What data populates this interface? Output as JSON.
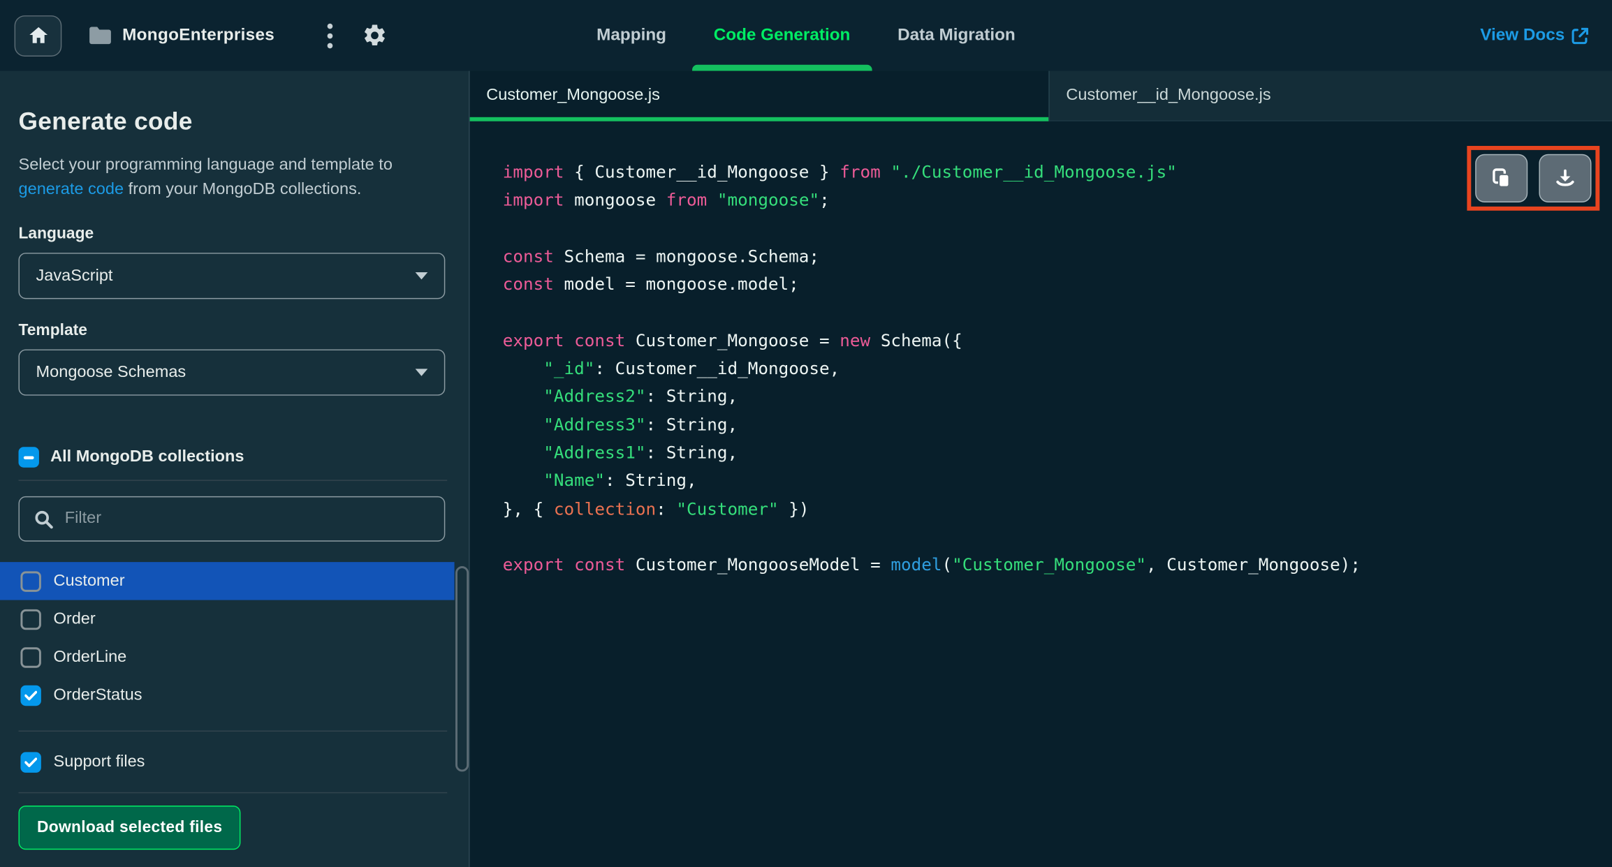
{
  "topbar": {
    "project_name": "MongoEnterprises",
    "nav_tabs": [
      {
        "label": "Mapping",
        "active": false
      },
      {
        "label": "Code Generation",
        "active": true
      },
      {
        "label": "Data Migration",
        "active": false
      }
    ],
    "view_docs_label": "View Docs"
  },
  "sidebar": {
    "title": "Generate code",
    "description": {
      "prefix": "Select your programming language and template to ",
      "link": "generate code",
      "suffix": " from your MongoDB collections."
    },
    "language": {
      "label": "Language",
      "value": "JavaScript"
    },
    "template": {
      "label": "Template",
      "value": "Mongoose Schemas"
    },
    "all_collections": {
      "label": "All MongoDB collections",
      "checkbox_state": "indeterminate"
    },
    "filter": {
      "placeholder": "Filter"
    },
    "collections": [
      {
        "name": "Customer",
        "checked": false,
        "selected": true
      },
      {
        "name": "Order",
        "checked": false,
        "selected": false
      },
      {
        "name": "OrderLine",
        "checked": false,
        "selected": false
      },
      {
        "name": "OrderStatus",
        "checked": true,
        "selected": false
      }
    ],
    "support_files": {
      "label": "Support files",
      "checked": true
    },
    "download_button_label": "Download selected files"
  },
  "editor": {
    "file_tabs": [
      {
        "label": "Customer_Mongoose.js",
        "active": true
      },
      {
        "label": "Customer__id_Mongoose.js",
        "active": false
      }
    ],
    "actions": [
      {
        "name": "copy",
        "icon": "copy-icon"
      },
      {
        "name": "download",
        "icon": "download-icon"
      }
    ],
    "code_lines": [
      {
        "tokens": [
          {
            "t": "kw",
            "v": "import"
          },
          {
            "t": "pl",
            "v": " { Customer__id_Mongoose } "
          },
          {
            "t": "kw",
            "v": "from"
          },
          {
            "t": "pl",
            "v": " "
          },
          {
            "t": "str",
            "v": "\"./Customer__id_Mongoose.js\""
          }
        ]
      },
      {
        "tokens": [
          {
            "t": "kw",
            "v": "import"
          },
          {
            "t": "pl",
            "v": " mongoose "
          },
          {
            "t": "kw",
            "v": "from"
          },
          {
            "t": "pl",
            "v": " "
          },
          {
            "t": "str",
            "v": "\"mongoose\""
          },
          {
            "t": "pl",
            "v": ";"
          }
        ]
      },
      {
        "tokens": []
      },
      {
        "tokens": [
          {
            "t": "kw",
            "v": "const"
          },
          {
            "t": "pl",
            "v": " Schema = mongoose.Schema;"
          }
        ]
      },
      {
        "tokens": [
          {
            "t": "kw",
            "v": "const"
          },
          {
            "t": "pl",
            "v": " model = mongoose.model;"
          }
        ]
      },
      {
        "tokens": []
      },
      {
        "tokens": [
          {
            "t": "kw",
            "v": "export"
          },
          {
            "t": "pl",
            "v": " "
          },
          {
            "t": "kw",
            "v": "const"
          },
          {
            "t": "pl",
            "v": " Customer_Mongoose = "
          },
          {
            "t": "kw",
            "v": "new"
          },
          {
            "t": "pl",
            "v": " Schema({"
          }
        ]
      },
      {
        "tokens": [
          {
            "t": "pl",
            "v": "    "
          },
          {
            "t": "str",
            "v": "\"_id\""
          },
          {
            "t": "pl",
            "v": ": Customer__id_Mongoose,"
          }
        ]
      },
      {
        "tokens": [
          {
            "t": "pl",
            "v": "    "
          },
          {
            "t": "str",
            "v": "\"Address2\""
          },
          {
            "t": "pl",
            "v": ": String,"
          }
        ]
      },
      {
        "tokens": [
          {
            "t": "pl",
            "v": "    "
          },
          {
            "t": "str",
            "v": "\"Address3\""
          },
          {
            "t": "pl",
            "v": ": String,"
          }
        ]
      },
      {
        "tokens": [
          {
            "t": "pl",
            "v": "    "
          },
          {
            "t": "str",
            "v": "\"Address1\""
          },
          {
            "t": "pl",
            "v": ": String,"
          }
        ]
      },
      {
        "tokens": [
          {
            "t": "pl",
            "v": "    "
          },
          {
            "t": "str",
            "v": "\"Name\""
          },
          {
            "t": "pl",
            "v": ": String,"
          }
        ]
      },
      {
        "tokens": [
          {
            "t": "pl",
            "v": "}, { "
          },
          {
            "t": "attr",
            "v": "collection"
          },
          {
            "t": "pl",
            "v": ": "
          },
          {
            "t": "str",
            "v": "\"Customer\""
          },
          {
            "t": "pl",
            "v": " })"
          }
        ]
      },
      {
        "tokens": []
      },
      {
        "tokens": [
          {
            "t": "kw",
            "v": "export"
          },
          {
            "t": "pl",
            "v": " "
          },
          {
            "t": "kw",
            "v": "const"
          },
          {
            "t": "pl",
            "v": " Customer_MongooseModel = "
          },
          {
            "t": "fn",
            "v": "model"
          },
          {
            "t": "pl",
            "v": "("
          },
          {
            "t": "str",
            "v": "\"Customer_Mongoose\""
          },
          {
            "t": "pl",
            "v": ", Customer_Mongoose);"
          }
        ]
      }
    ]
  },
  "colors": {
    "topbar_bg": "#0B2330",
    "sidebar_bg": "#16303B",
    "editor_bg": "#081F2B",
    "accent_green": "#00ED64",
    "tab_underline_green": "#14C05F",
    "link_blue": "#1C9BE5",
    "checkbox_blue": "#0498EC",
    "selected_row_blue": "#1254B7",
    "button_green_bg": "#00684A",
    "annotation_red": "#E8441F",
    "code_keyword": "#EC5B97",
    "code_string": "#35DE7B",
    "code_property": "#EC7251",
    "code_function": "#2F9EDF"
  },
  "icons": [
    "home-icon",
    "folder-icon",
    "kebab-menu-icon",
    "gear-icon",
    "external-link-icon",
    "caret-down-icon",
    "search-icon",
    "checkbox-check-icon",
    "checkbox-minus-icon",
    "copy-icon",
    "download-icon",
    "scrollbar-thumb"
  ]
}
